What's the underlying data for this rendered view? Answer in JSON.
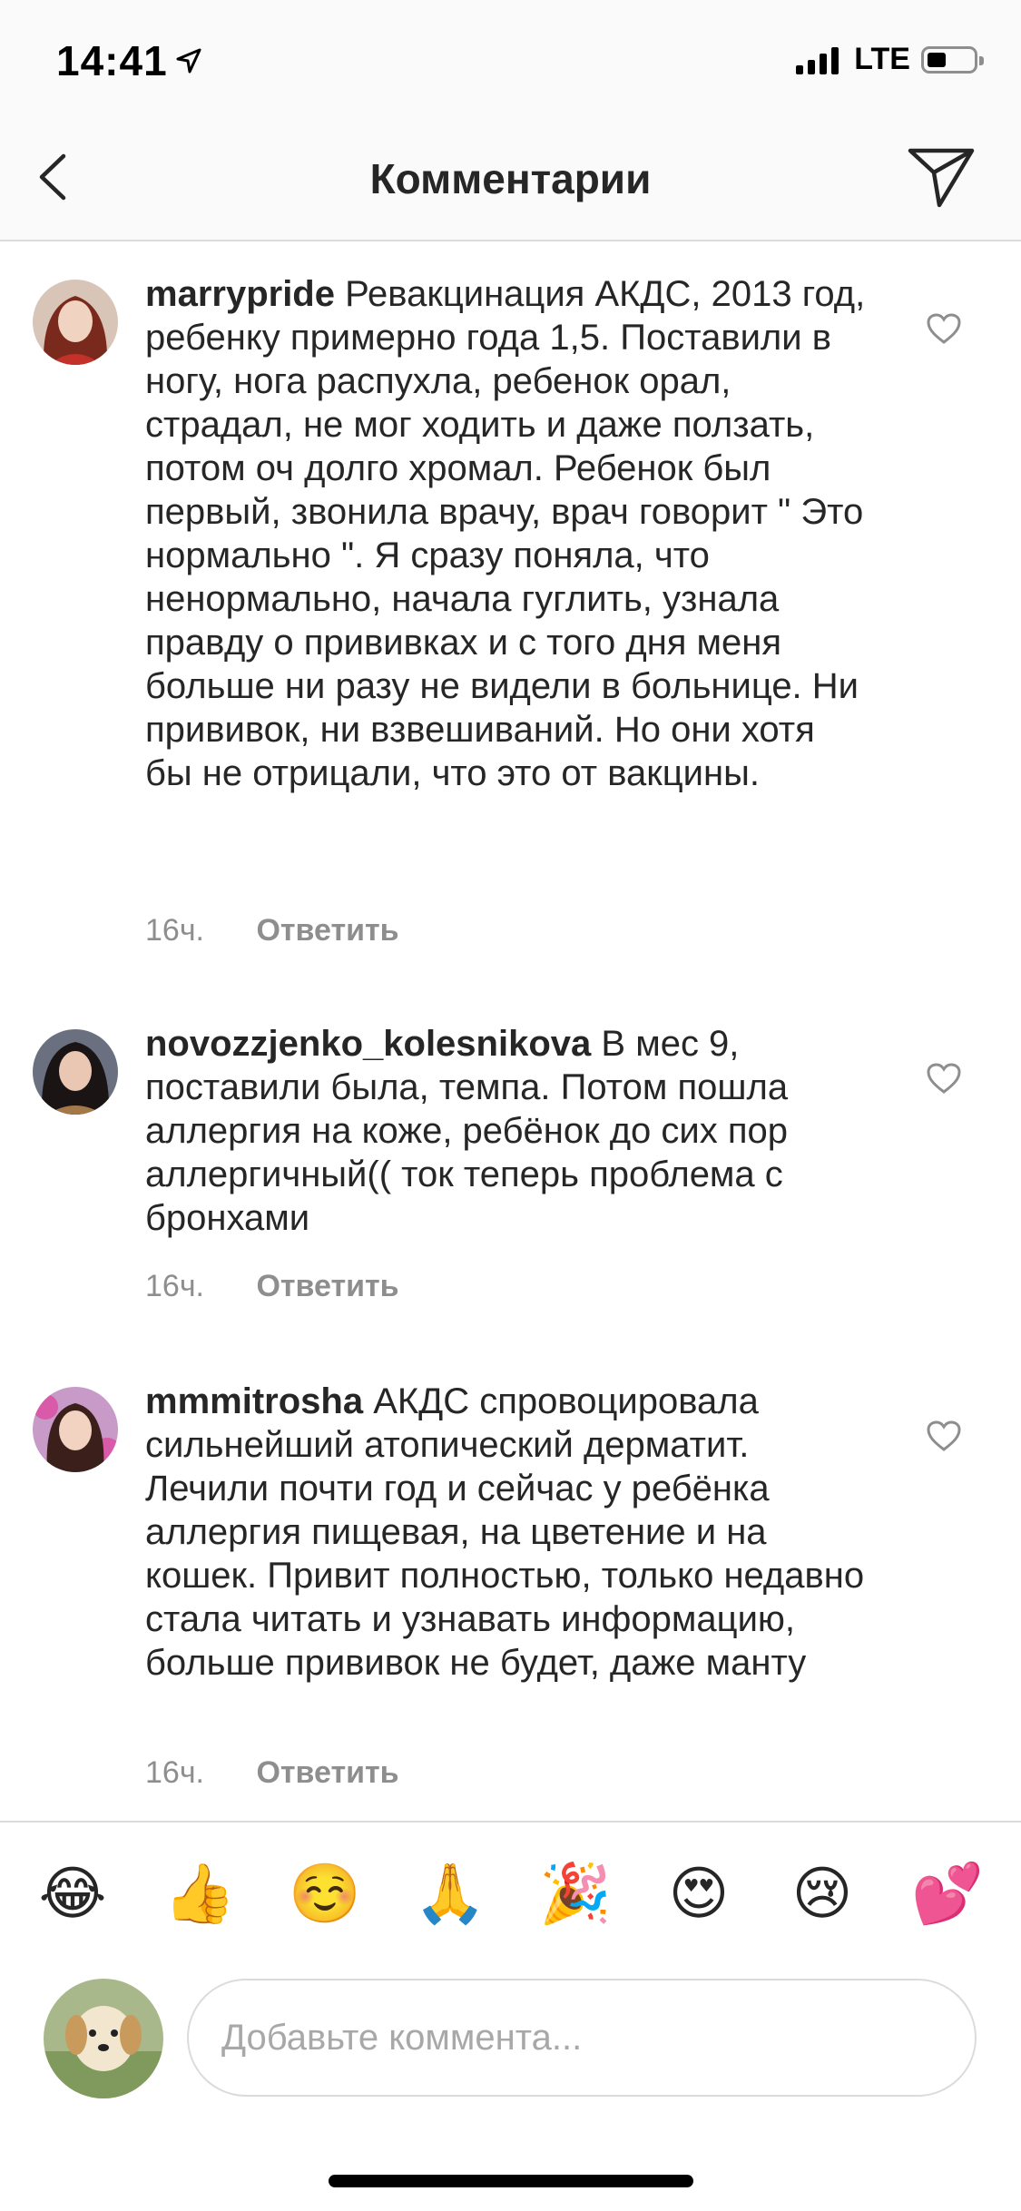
{
  "status_bar": {
    "time": "14:41",
    "network": "LTE"
  },
  "header": {
    "title": "Комментарии",
    "back_icon": "chevron-left-icon",
    "share_icon": "paper-plane-icon"
  },
  "comments": [
    {
      "username": "marrypride",
      "text": "Ревакцинация АКДС, 2013 год, ребенку примерно года 1,5. Поставили в ногу, нога распухла, ребенок орал, страдал, не мог ходить и даже ползать, потом оч долго хромал. Ребенок был первый, звонила врачу, врач говорит \" Это нормально \". Я сразу поняла, что ненормально, начала гуглить, узнала правду о прививках и с того дня меня больше ни разу не видели в больнице. Ни прививок, ни взвешиваний. Но они хотя бы не отрицали, что это от вакцины.",
      "time": "16ч.",
      "reply_label": "Ответить"
    },
    {
      "username": "novozzjenko_kolesnikova",
      "text": "В мес 9, поставили была, темпа. Потом пошла аллергия на коже, ребёнок до сих пор аллергичный(( ток теперь проблема с бронхами",
      "time": "16ч.",
      "reply_label": "Ответить"
    },
    {
      "username": "mmmitrosha",
      "text": "АКДС спровоцировала сильнейший атопический дерматит. Лечили почти год и сейчас у ребёнка аллергия пищевая, на цветение и на кошек. Привит полностью, только недавно стала читать и узнавать информацию, больше прививок не будет, даже манту",
      "time": "16ч.",
      "reply_label": "Ответить"
    }
  ],
  "emoji_bar": [
    "😂",
    "👍",
    "☺️",
    "🙏",
    "🎉",
    "😍",
    "😢",
    "💕"
  ],
  "composer": {
    "placeholder": "Добавьте коммента..."
  },
  "colors": {
    "text": "#262626",
    "secondary": "#8e8e8e",
    "border": "#dbdbdb",
    "header_bg": "#fafafa"
  }
}
